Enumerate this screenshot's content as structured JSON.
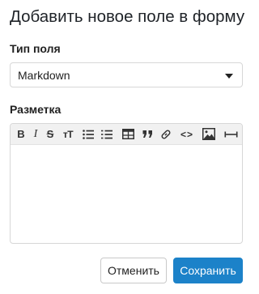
{
  "dialog": {
    "title": "Добавить новое поле в форму"
  },
  "field_type": {
    "label": "Тип поля",
    "selected": "Markdown"
  },
  "markup": {
    "label": "Разметка",
    "toolbar": {
      "bold": "B",
      "italic": "I",
      "strike": "S",
      "heading": "тT",
      "code": "<>",
      "icons": [
        "bold-icon",
        "italic-icon",
        "strikethrough-icon",
        "heading-icon",
        "bulleted-list-icon",
        "numbered-list-icon",
        "table-icon",
        "quote-icon",
        "link-icon",
        "code-icon",
        "image-icon",
        "horizontal-rule-icon"
      ]
    },
    "content": ""
  },
  "actions": {
    "cancel": "Отменить",
    "save": "Сохранить"
  },
  "colors": {
    "primary": "#1c82c9",
    "border": "#d7d7d7",
    "toolbar_bg": "#f1f1f1"
  }
}
